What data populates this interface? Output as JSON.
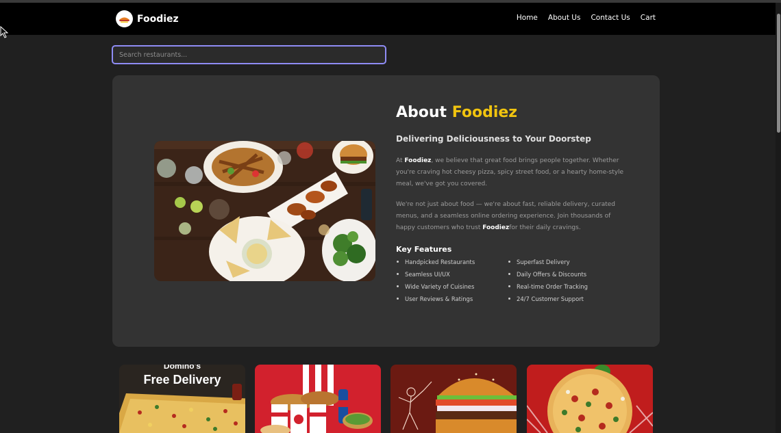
{
  "brand": {
    "name": "Foodiez"
  },
  "nav": {
    "items": [
      {
        "label": "Home"
      },
      {
        "label": "About Us"
      },
      {
        "label": "Contact Us"
      },
      {
        "label": "Cart"
      }
    ]
  },
  "search": {
    "placeholder": "Search restaurants...",
    "value": ""
  },
  "about": {
    "title_prefix": "About ",
    "title_highlight": "Foodiez",
    "subtitle": "Delivering Deliciousness to Your Doorstep",
    "para1": {
      "before": "At ",
      "bold": "Foodiez",
      "after": ", we believe that great food brings people together. Whether you're craving hot cheesy pizza, spicy street food, or a hearty home-style meal, we've got you covered."
    },
    "para2": {
      "before": "We're not just about food — we're about fast, reliable delivery, curated menus, and a seamless online ordering experience. Join thousands of happy customers who trust ",
      "bold": "Foodiez",
      "after": "for their daily cravings."
    },
    "features_title": "Key Features",
    "features": [
      "Handpicked Restaurants",
      "Superfast Delivery",
      "Seamless UI/UX",
      "Daily Offers & Discounts",
      "Wide Variety of Cuisines",
      "Real-time Order Tracking",
      "User Reviews & Ratings",
      "24/7 Customer Support"
    ]
  },
  "offers": [
    {
      "brand": "Domino's",
      "caption": "Free Delivery"
    },
    {
      "brand": "KFC",
      "caption": ""
    },
    {
      "brand": "",
      "caption": ""
    },
    {
      "brand": "",
      "caption": ""
    }
  ],
  "colors": {
    "accent": "#f1c40f",
    "search_border": "#8f8cf5",
    "navbar": "#000000",
    "card": "#333333",
    "background": "#202020"
  }
}
